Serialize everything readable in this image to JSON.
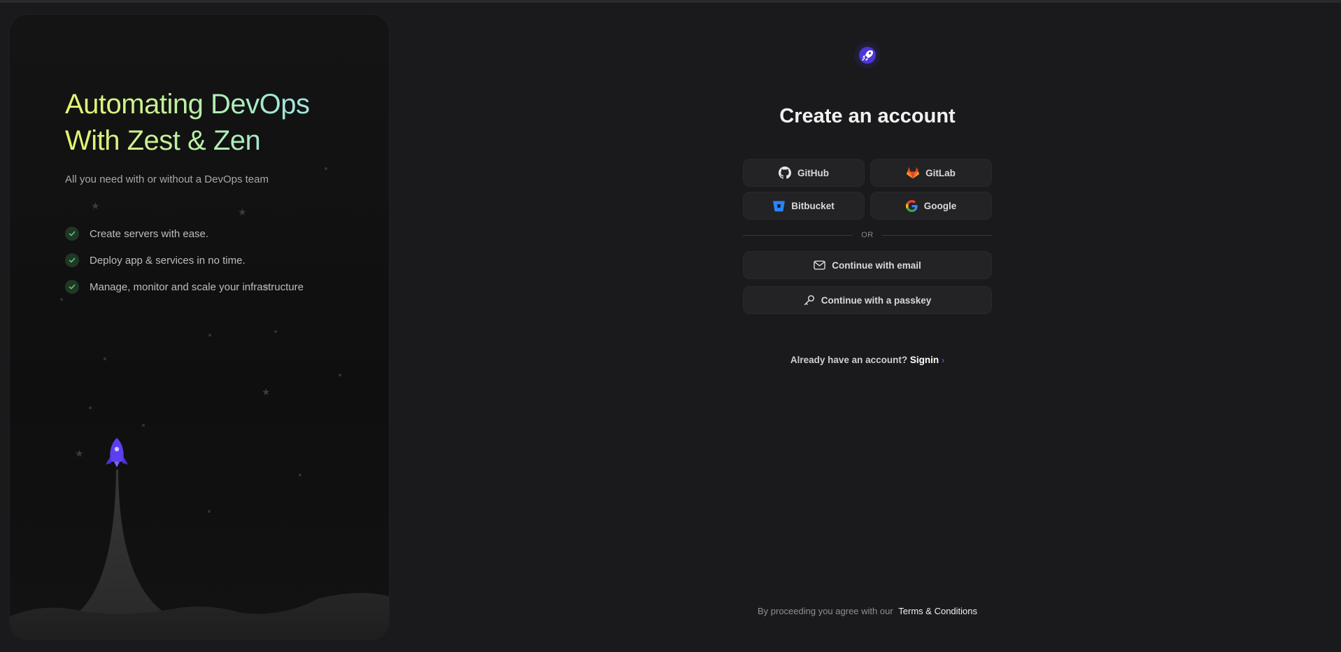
{
  "hero": {
    "title_line1": "Automating DevOps",
    "title_line2": "With Zest & Zen",
    "subtitle": "All you need with or without a DevOps team",
    "features": [
      "Create servers with ease.",
      "Deploy app & services in no time.",
      "Manage, monitor and scale your infrastructure"
    ]
  },
  "auth": {
    "title": "Create an account",
    "providers": {
      "github": "GitHub",
      "gitlab": "GitLab",
      "bitbucket": "Bitbucket",
      "google": "Google"
    },
    "divider": "OR",
    "email_label": "Continue with email",
    "passkey_label": "Continue with a passkey",
    "already_text": "Already have an account?",
    "signin_link": "Signin",
    "signin_arrow": "›",
    "terms_text": "By proceeding you agree with our",
    "terms_link": "Terms & Conditions"
  },
  "colors": {
    "background": "#1a1a1c",
    "accent": "#5b4ae8",
    "title_gradient_start": "#e8f56b",
    "title_gradient_end": "#a9e6ee"
  }
}
